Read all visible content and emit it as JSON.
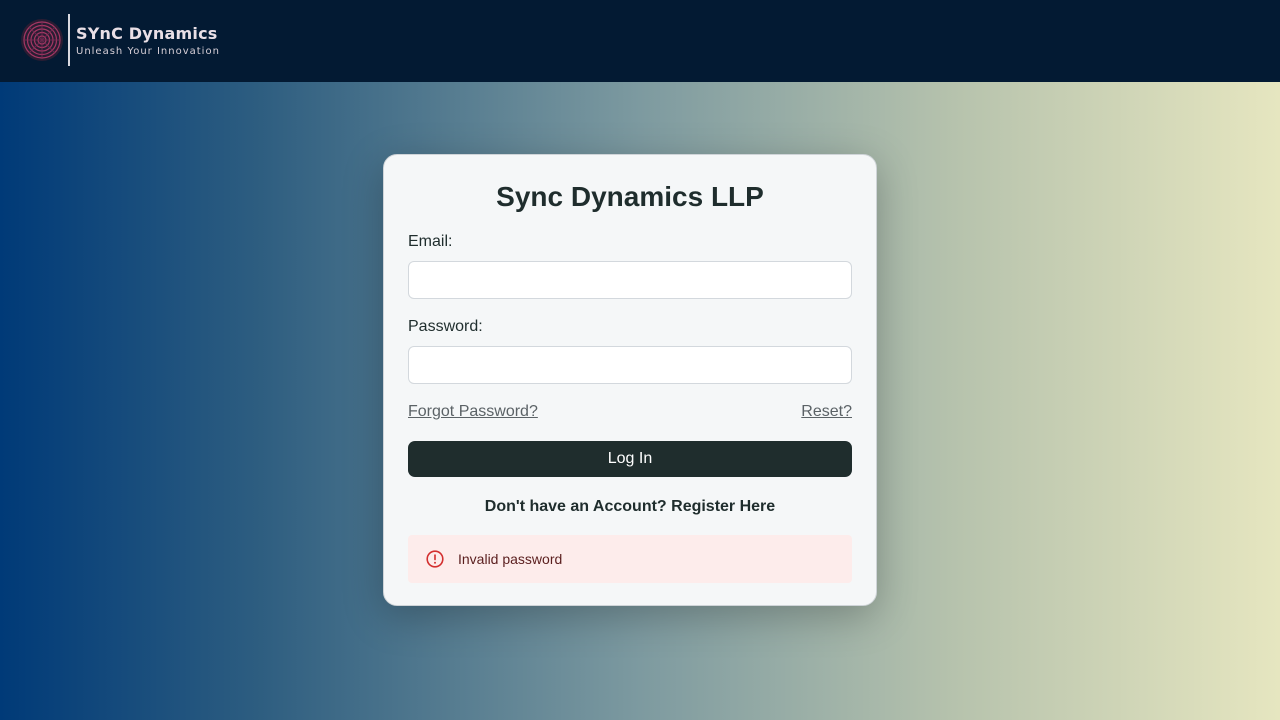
{
  "header": {
    "brand_name": "SYnC Dynamics",
    "brand_tagline": "Unleash Your Innovation",
    "logo_icon": "fingerprint-icon"
  },
  "login": {
    "title": "Sync Dynamics LLP",
    "email_label": "Email:",
    "email_value": "",
    "password_label": "Password:",
    "password_value": "",
    "forgot_link": "Forgot Password?",
    "reset_link": "Reset?",
    "login_button": "Log In",
    "register_text": "Don't have an Account? Register Here"
  },
  "alert": {
    "icon": "alert-circle-icon",
    "message": "Invalid password",
    "color": "#d32f2f",
    "background": "#fdeceb"
  },
  "colors": {
    "topbar": "#031a33",
    "primary_button": "#1f2d2d",
    "gradient_start": "#003a78",
    "gradient_end": "#e6e6c0"
  }
}
